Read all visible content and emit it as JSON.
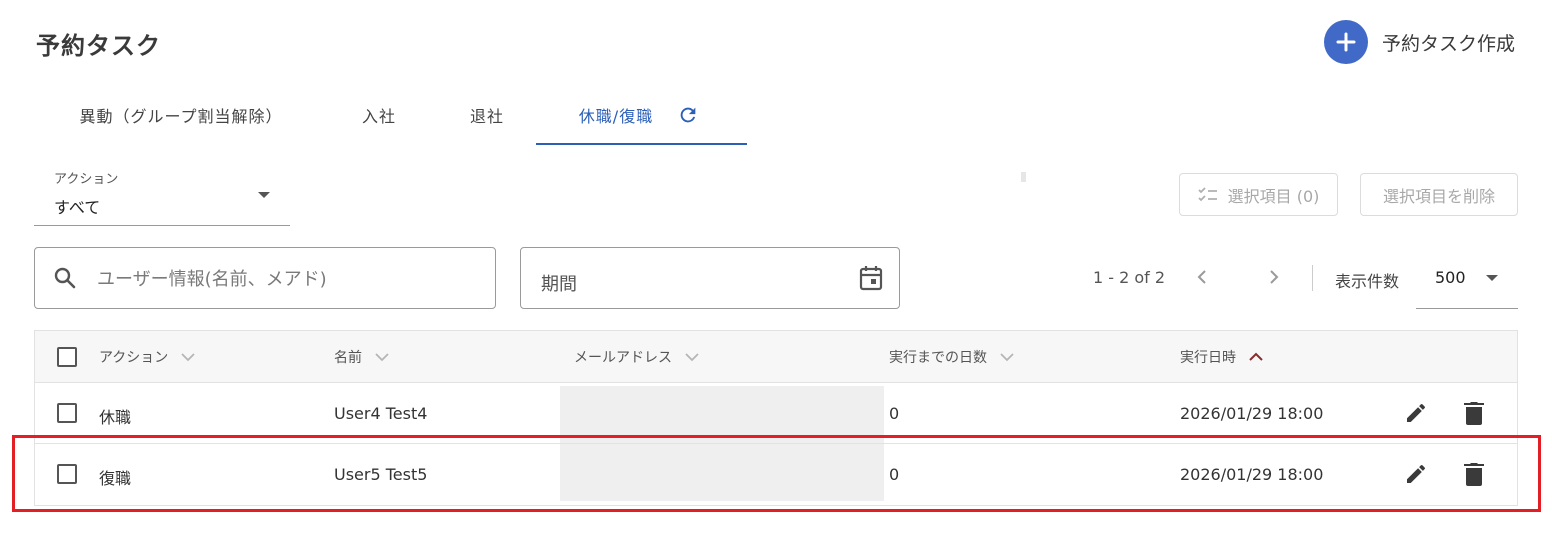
{
  "page": {
    "title": "予約タスク",
    "create_label": "予約タスク作成"
  },
  "tabs": [
    {
      "label": "異動（グループ割当解除）"
    },
    {
      "label": "入社"
    },
    {
      "label": "退社"
    },
    {
      "label": "休職/復職",
      "active": true
    }
  ],
  "filters": {
    "action_caption": "アクション",
    "action_value": "すべて",
    "search_placeholder": "ユーザー情報(名前、メアド)",
    "period_label": "期間"
  },
  "toolbar": {
    "select_count_label": "選択項目 (0)",
    "delete_selected_label": "選択項目を削除"
  },
  "pagination": {
    "range": "1 - 2 of 2",
    "per_page_label": "表示件数",
    "per_page_value": "500"
  },
  "table": {
    "columns": [
      "アクション",
      "名前",
      "メールアドレス",
      "実行までの日数",
      "実行日時"
    ],
    "sort": {
      "column": "実行日時",
      "direction": "ascending"
    },
    "rows": [
      {
        "action": "休職",
        "name": "User4 Test4",
        "email": "",
        "days": "0",
        "datetime": "2026/01/29 18:00"
      },
      {
        "action": "復職",
        "name": "User5 Test5",
        "email": "",
        "days": "0",
        "datetime": "2026/01/29 18:00"
      }
    ]
  },
  "colors": {
    "accent": "#2c5fb8",
    "create_button": "#4169c7",
    "highlight": "#e31e25",
    "sort_active": "#8b2c2c"
  },
  "icons": [
    "plus-icon",
    "refresh-icon",
    "dropdown-caret-icon",
    "checklist-icon",
    "search-icon",
    "calendar-icon",
    "chevron-left-icon",
    "chevron-right-icon",
    "sort-chevron-icon",
    "pencil-icon",
    "trash-icon"
  ]
}
